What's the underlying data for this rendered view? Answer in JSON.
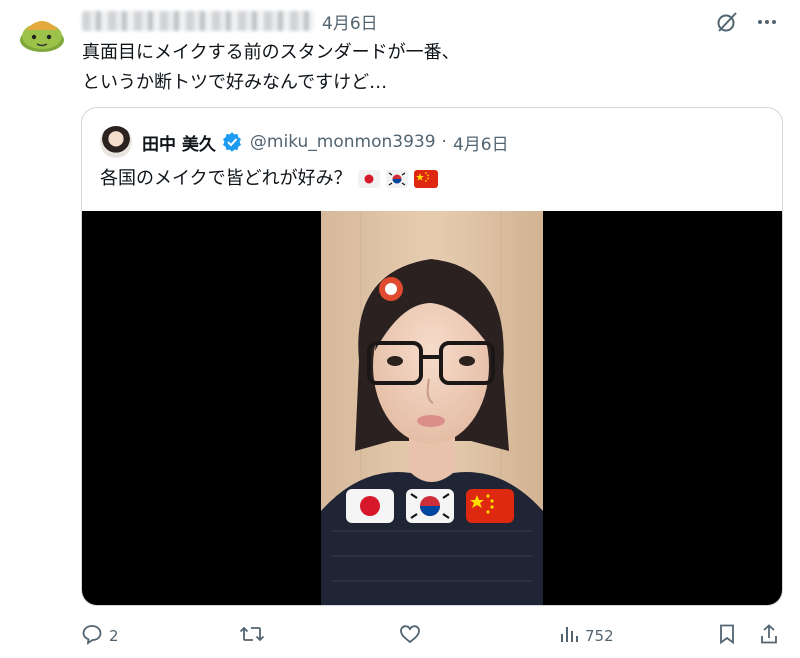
{
  "post": {
    "date": "4月6日",
    "text_line1": "真面目にメイクする前のスタンダードが一番、",
    "text_line2": "というか断トツで好みなんですけど…"
  },
  "quote": {
    "name": "田中 美久",
    "handle": "@miku_monmon3939",
    "separator": "·",
    "date": "4月6日",
    "text": "各国のメイクで皆どれが好み？"
  },
  "actions": {
    "reply_count": "2",
    "view_count": "752"
  },
  "icons": [
    "grok-icon",
    "more-icon",
    "verified-icon",
    "reply-icon",
    "retweet-icon",
    "like-icon",
    "views-icon",
    "bookmark-icon",
    "share-icon"
  ],
  "colors": {
    "verified": "#1d9bf0",
    "muted": "#536471",
    "text": "#0f1419",
    "border": "#cfd9de"
  }
}
